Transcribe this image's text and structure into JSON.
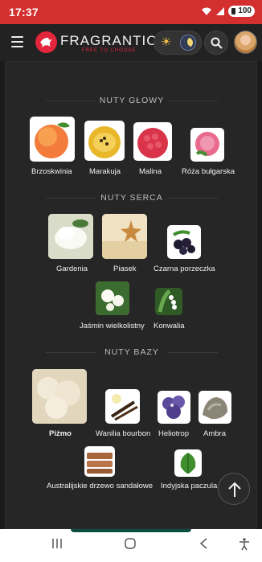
{
  "status": {
    "time": "17:37",
    "battery": "100"
  },
  "header": {
    "logo_text": "FRAGRANTICA",
    "logo_sub": "FREE TO CHOOSE"
  },
  "sections": {
    "top": {
      "title": "NUTY GŁOWY",
      "notes": [
        {
          "label": "Brzoskwinia",
          "icon": "peach"
        },
        {
          "label": "Marakuja",
          "icon": "passion-fruit"
        },
        {
          "label": "Malina",
          "icon": "raspberry"
        },
        {
          "label": "Róża bułgarska",
          "icon": "bulgarian-rose"
        }
      ]
    },
    "heart": {
      "title": "NUTY SERCA",
      "notes": [
        {
          "label": "Gardenia",
          "icon": "gardenia"
        },
        {
          "label": "Piasek",
          "icon": "sand"
        },
        {
          "label": "Czarna porzeczka",
          "icon": "black-currant"
        },
        {
          "label": "Jaśmin wielkolistny",
          "icon": "jasmine-sambac"
        },
        {
          "label": "Konwalia",
          "icon": "lily-of-the-valley"
        }
      ]
    },
    "base": {
      "title": "NUTY BAZY",
      "notes": [
        {
          "label": "Piżmo",
          "icon": "musk"
        },
        {
          "label": "Wanilia bourbon",
          "icon": "bourbon-vanilla"
        },
        {
          "label": "Heliotrop",
          "icon": "heliotrope"
        },
        {
          "label": "Ambra",
          "icon": "amber"
        },
        {
          "label": "Australijskie drzewo sandałowe",
          "icon": "australian-sandalwood"
        },
        {
          "label": "Indyjska paczula",
          "icon": "indian-patchouli"
        }
      ]
    }
  },
  "colors": {
    "brand": "#e3263b",
    "status_bar": "#d32f2f",
    "background": "#262626"
  }
}
